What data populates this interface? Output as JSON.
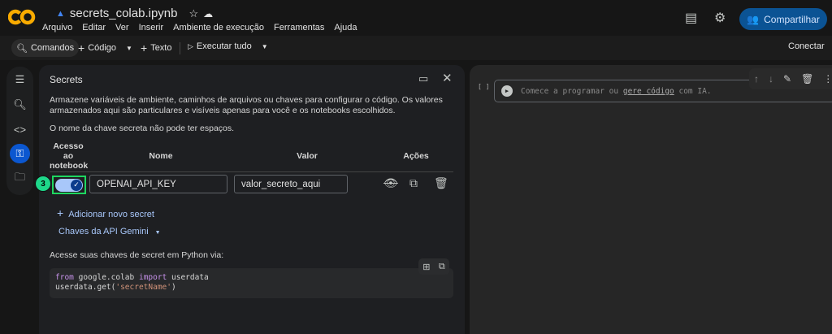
{
  "header": {
    "filename": "secrets_colab.ipynb",
    "menu": [
      "Arquivo",
      "Editar",
      "Ver",
      "Inserir",
      "Ambiente de execução",
      "Ferramentas",
      "Ajuda"
    ],
    "share": "Compartilhar"
  },
  "toolbar": {
    "commands": "Comandos",
    "code": "Código",
    "text": "Texto",
    "run_all": "Executar tudo",
    "connect": "Conectar"
  },
  "secrets": {
    "title": "Secrets",
    "description": "Armazene variáveis de ambiente, caminhos de arquivos ou chaves para configurar o código. Os valores armazenados aqui são particulares e visíveis apenas para você e os notebooks escolhidos.",
    "note": "O nome da chave secreta não pode ter espaços.",
    "columns": {
      "access": "Acesso ao notebook",
      "name": "Nome",
      "value": "Valor",
      "actions": "Ações"
    },
    "rows": [
      {
        "access": true,
        "name": "OPENAI_API_KEY",
        "value": "valor_secreto_aqui"
      }
    ],
    "badge": "3",
    "add": "Adicionar novo secret",
    "gemini": "Chaves da API Gemini",
    "access_label": "Acesse suas chaves de secret em Python via:",
    "code": {
      "l1_kw1": "from",
      "l1_mod": " google.colab ",
      "l1_kw2": "import",
      "l1_name": " userdata",
      "l2_pre": "userdata.get(",
      "l2_str": "'secretName'",
      "l2_post": ")"
    }
  },
  "notebook": {
    "brackets": "[ ]",
    "placeholder_pre": "Comece a programar ou ",
    "placeholder_link": "gere código",
    "placeholder_post": " com IA."
  }
}
